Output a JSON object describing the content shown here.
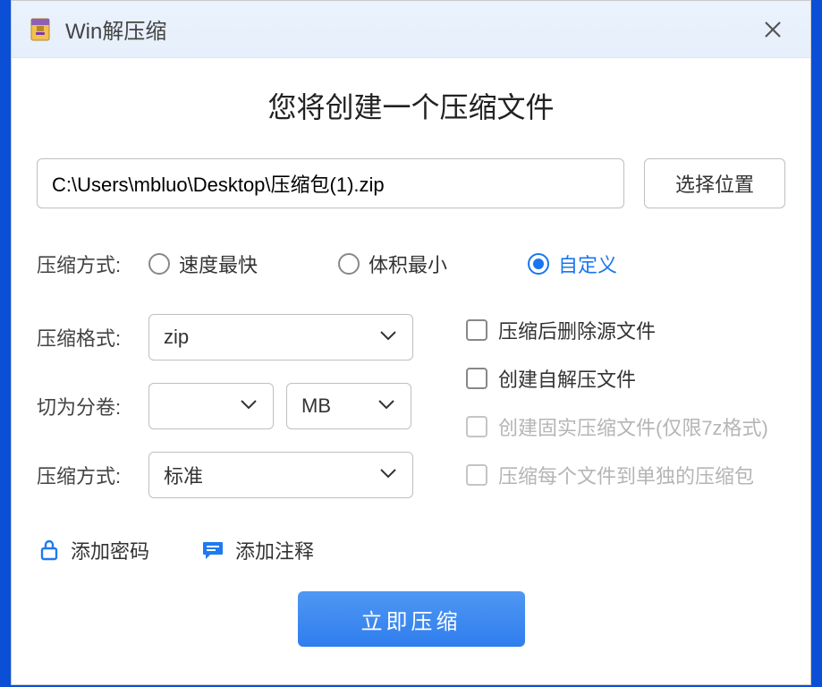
{
  "window": {
    "title": "Win解压缩"
  },
  "headline": "您将创建一个压缩文件",
  "path": {
    "value": "C:\\Users\\mbluo\\Desktop\\压缩包(1).zip",
    "browse": "选择位置"
  },
  "mode": {
    "label": "压缩方式:",
    "options": {
      "fastest": "速度最快",
      "smallest": "体积最小",
      "custom": "自定义"
    },
    "selected": "custom"
  },
  "format": {
    "label": "压缩格式:",
    "value": "zip"
  },
  "split": {
    "label": "切为分卷:",
    "size_value": "",
    "unit_value": "MB"
  },
  "level": {
    "label": "压缩方式:",
    "value": "标准"
  },
  "checks": {
    "delete_source": "压缩后删除源文件",
    "self_extract": "创建自解压文件",
    "solid_7z": "创建固实压缩文件(仅限7z格式)",
    "each_file": "压缩每个文件到单独的压缩包"
  },
  "links": {
    "password": "添加密码",
    "comment": "添加注释"
  },
  "action": {
    "compress": "立即压缩"
  }
}
